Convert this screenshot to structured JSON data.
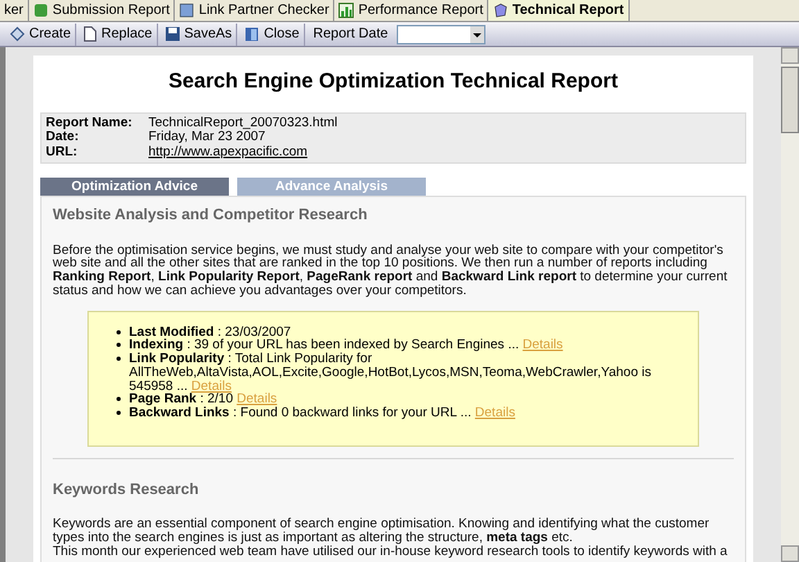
{
  "tabs": [
    {
      "label": "ker",
      "selected": false
    },
    {
      "label": "Submission Report",
      "selected": false
    },
    {
      "label": "Link Partner Checker",
      "selected": false
    },
    {
      "label": "Performance Report",
      "selected": false
    },
    {
      "label": "Technical Report",
      "selected": true
    }
  ],
  "toolbar": {
    "buttons": [
      {
        "label": "Create",
        "kind": "create"
      },
      {
        "label": "Replace",
        "kind": "replace"
      },
      {
        "label": "SaveAs",
        "kind": "save"
      },
      {
        "label": "Close",
        "kind": "close"
      }
    ],
    "report_date_label": "Report Date"
  },
  "report": {
    "title": "Search Engine Optimization Technical Report",
    "info": [
      {
        "label": "Report Name:",
        "value": "TechnicalReport_20070323.html",
        "kind": "text"
      },
      {
        "label": "Date:",
        "value": "Friday, Mar 23 2007",
        "kind": "text"
      },
      {
        "label": "URL:",
        "value": "http://www.apexpacific.com",
        "kind": "link"
      }
    ],
    "tabs": [
      {
        "label": "Optimization Advice",
        "selected": true
      },
      {
        "label": "Advance Analysis",
        "selected": false
      }
    ],
    "sections": [
      {
        "heading": "Website Analysis and Competitor Research",
        "paragraphs": [
          "Before the optimisation service begins, we must study and analyse your web site to compare with your competitor's web site and all the other sites that are ranked in the top 10 positions. We then run a number of reports including **Ranking Report**, **Link Popularity Report**, **PageRank report** and **Backward Link report** to determine your current status and how we can achieve you advantages over your competitors."
        ],
        "summary": [
          {
            "label": "Last Modified",
            "text": " : 23/03/2007"
          },
          {
            "label": "Indexing",
            "text": " : 39 of your URL has been indexed by Search Engines ...",
            "link": "Details"
          },
          {
            "label": "Link Popularity",
            "text": " : Total Link Popularity for AllTheWeb,AltaVista,AOL,Excite,Google,HotBot,Lycos,MSN,Teoma,WebCrawler,Yahoo is 545958 ...",
            "link": "Details"
          },
          {
            "label": "Page Rank",
            "text": " : 2/10",
            "link": "Details"
          },
          {
            "label": "Backward Links",
            "text": " : Found 0 backward links for your URL ...",
            "link": "Details"
          }
        ]
      },
      {
        "heading": "Keywords Research",
        "paragraphs": [
          "Keywords are an essential component of search engine optimisation. Knowing and identifying what the customer types into the search engines is just as important as altering the structure, **meta tags** etc.",
          "This month our experienced web team have utilised our in-house keyword research tools to identify keywords with a"
        ]
      }
    ]
  }
}
